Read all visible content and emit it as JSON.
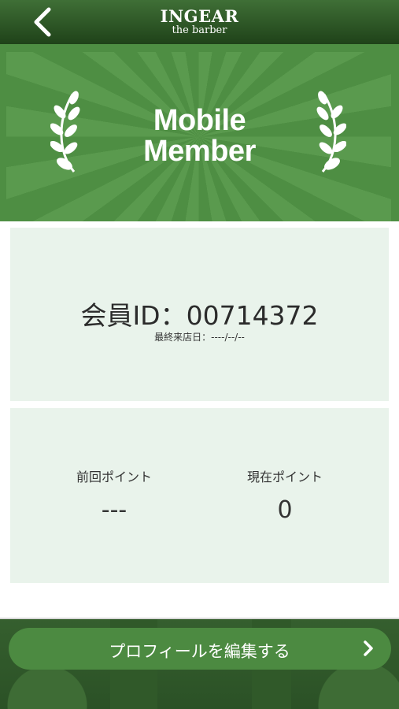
{
  "header": {
    "logo_main": "INGEAR",
    "logo_sub": "the barber",
    "back_icon": "chevron-left-icon"
  },
  "banner": {
    "title_line1": "Mobile",
    "title_line2": "Member",
    "decoration_icon": "laurel-icon"
  },
  "member": {
    "id_text": "会員ID：00714372",
    "last_visit_text": "最終来店日：----/--/--"
  },
  "points": {
    "previous_label": "前回ポイント",
    "previous_value": "---",
    "current_label": "現在ポイント",
    "current_value": "0"
  },
  "footer": {
    "edit_profile_label": "プロフィールを編集する",
    "chevron_icon": "chevron-right-icon"
  },
  "colors": {
    "brand_green": "#4e8e43",
    "header_dark": "#1f4219",
    "card_bg": "#e9f3eb"
  }
}
